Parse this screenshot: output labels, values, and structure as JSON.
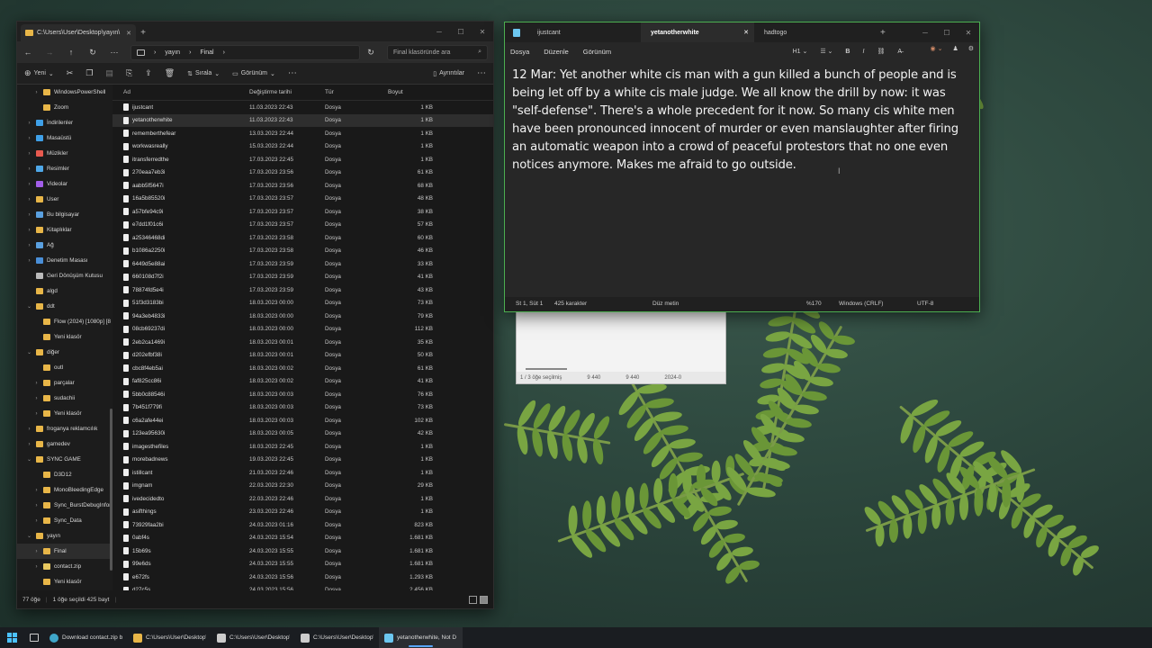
{
  "explorer": {
    "tab_title": "C:\\Users\\User\\Desktop\\yayın\\",
    "breadcrumb": [
      "yayın",
      "Final"
    ],
    "search_placeholder": "Final klasöründe ara",
    "commands": {
      "new": "Yeni",
      "sort": "Sırala",
      "view": "Görünüm",
      "details": "Ayrıntılar"
    },
    "columns": {
      "name": "Ad",
      "date": "Değiştirme tarihi",
      "type": "Tür",
      "size": "Boyut"
    },
    "nav": [
      {
        "label": "WindowsPowerShell",
        "indent": 1,
        "chev": true,
        "color": "#e8b648"
      },
      {
        "label": "Zoom",
        "indent": 1,
        "chev": false,
        "color": "#e8b648"
      },
      {
        "label": "İndirilenler",
        "indent": 0,
        "chev": true,
        "color": "#3fa0e8"
      },
      {
        "label": "Masaüstü",
        "indent": 0,
        "chev": true,
        "color": "#3fa0e8"
      },
      {
        "label": "Müzikler",
        "indent": 0,
        "chev": true,
        "color": "#e85a4f"
      },
      {
        "label": "Resimler",
        "indent": 0,
        "chev": true,
        "color": "#4fa8e8"
      },
      {
        "label": "Videolar",
        "indent": 0,
        "chev": true,
        "color": "#a25ee8"
      },
      {
        "label": "User",
        "indent": 0,
        "chev": true,
        "color": "#e8b648"
      },
      {
        "label": "Bu bilgisayar",
        "indent": 0,
        "chev": true,
        "color": "#5aa0e0"
      },
      {
        "label": "Kitaplıklar",
        "indent": 0,
        "chev": true,
        "color": "#e8b648"
      },
      {
        "label": "Ağ",
        "indent": 0,
        "chev": true,
        "color": "#5aa0e0"
      },
      {
        "label": "Denetim Masası",
        "indent": 0,
        "chev": true,
        "color": "#4a8fd8"
      },
      {
        "label": "Geri Dönüşüm Kutusu",
        "indent": 0,
        "chev": false,
        "color": "#bbbbbb"
      },
      {
        "label": "algd",
        "indent": 0,
        "chev": false,
        "color": "#e8b648"
      },
      {
        "label": "ddt",
        "indent": 0,
        "chev": true,
        "open": true,
        "color": "#e8b648"
      },
      {
        "label": "Flow (2024) [1080p] [8",
        "indent": 1,
        "chev": false,
        "color": "#e8b648"
      },
      {
        "label": "Yeni klasör",
        "indent": 1,
        "chev": false,
        "color": "#e8b648"
      },
      {
        "label": "diğer",
        "indent": 0,
        "chev": true,
        "open": true,
        "color": "#e8b648"
      },
      {
        "label": "outl",
        "indent": 1,
        "chev": false,
        "color": "#e8b648"
      },
      {
        "label": "parçalar",
        "indent": 1,
        "chev": true,
        "color": "#e8b648"
      },
      {
        "label": "sudachii",
        "indent": 1,
        "chev": true,
        "color": "#e8b648"
      },
      {
        "label": "Yeni klasör",
        "indent": 1,
        "chev": true,
        "color": "#e8b648"
      },
      {
        "label": "froganya reklamcılık",
        "indent": 0,
        "chev": true,
        "color": "#e8b648"
      },
      {
        "label": "gamedev",
        "indent": 0,
        "chev": true,
        "color": "#e8b648"
      },
      {
        "label": "SYNC GAME",
        "indent": 0,
        "chev": true,
        "open": true,
        "color": "#e8b648"
      },
      {
        "label": "D3D12",
        "indent": 1,
        "chev": false,
        "color": "#e8b648"
      },
      {
        "label": "MonoBleedingEdge",
        "indent": 1,
        "chev": true,
        "color": "#e8b648"
      },
      {
        "label": "Sync_BurstDebugInforr",
        "indent": 1,
        "chev": true,
        "color": "#e8b648"
      },
      {
        "label": "Sync_Data",
        "indent": 1,
        "chev": true,
        "color": "#e8b648"
      },
      {
        "label": "yayın",
        "indent": 0,
        "chev": true,
        "open": true,
        "color": "#e8b648"
      },
      {
        "label": "Final",
        "indent": 1,
        "chev": true,
        "sel": true,
        "color": "#e8b648"
      },
      {
        "label": "contact.zip",
        "indent": 1,
        "chev": true,
        "color": "#e8c860"
      },
      {
        "label": "Yeni klasör",
        "indent": 1,
        "chev": false,
        "color": "#e8b648"
      }
    ],
    "files": [
      {
        "name": "ijustcant",
        "date": "11.03.2023 22:43",
        "type": "Dosya",
        "size": "1 KB"
      },
      {
        "name": "yetanotherwhite",
        "date": "11.03.2023 22:43",
        "type": "Dosya",
        "size": "1 KB",
        "sel": true
      },
      {
        "name": "rememberthefear",
        "date": "13.03.2023 22:44",
        "type": "Dosya",
        "size": "1 KB"
      },
      {
        "name": "workwasreally",
        "date": "15.03.2023 22:44",
        "type": "Dosya",
        "size": "1 KB"
      },
      {
        "name": "itransferredthe",
        "date": "17.03.2023 22:45",
        "type": "Dosya",
        "size": "1 KB"
      },
      {
        "name": "270eaa7eb3i",
        "date": "17.03.2023 23:56",
        "type": "Dosya",
        "size": "61 KB"
      },
      {
        "name": "aabb5f5647i",
        "date": "17.03.2023 23:56",
        "type": "Dosya",
        "size": "68 KB"
      },
      {
        "name": "16a5b85520i",
        "date": "17.03.2023 23:57",
        "type": "Dosya",
        "size": "48 KB"
      },
      {
        "name": "a57bfe94c9i",
        "date": "17.03.2023 23:57",
        "type": "Dosya",
        "size": "38 KB"
      },
      {
        "name": "e7dd1f01c6i",
        "date": "17.03.2023 23:57",
        "type": "Dosya",
        "size": "57 KB"
      },
      {
        "name": "a25346468di",
        "date": "17.03.2023 23:58",
        "type": "Dosya",
        "size": "60 KB"
      },
      {
        "name": "b1086a2250i",
        "date": "17.03.2023 23:58",
        "type": "Dosya",
        "size": "46 KB"
      },
      {
        "name": "6449d5e88ai",
        "date": "17.03.2023 23:59",
        "type": "Dosya",
        "size": "33 KB"
      },
      {
        "name": "660108d7f2i",
        "date": "17.03.2023 23:59",
        "type": "Dosya",
        "size": "41 KB"
      },
      {
        "name": "78874fd5e4i",
        "date": "17.03.2023 23:59",
        "type": "Dosya",
        "size": "43 KB"
      },
      {
        "name": "51f3d3183bi",
        "date": "18.03.2023 00:00",
        "type": "Dosya",
        "size": "73 KB"
      },
      {
        "name": "94a3eb4833i",
        "date": "18.03.2023 00:00",
        "type": "Dosya",
        "size": "79 KB"
      },
      {
        "name": "08cb69237di",
        "date": "18.03.2023 00:00",
        "type": "Dosya",
        "size": "112 KB"
      },
      {
        "name": "2eb2ca1469i",
        "date": "18.03.2023 00:01",
        "type": "Dosya",
        "size": "35 KB"
      },
      {
        "name": "d202efbf38i",
        "date": "18.03.2023 00:01",
        "type": "Dosya",
        "size": "50 KB"
      },
      {
        "name": "cbc8f4eb5ai",
        "date": "18.03.2023 00:02",
        "type": "Dosya",
        "size": "61 KB"
      },
      {
        "name": "faf825cc86i",
        "date": "18.03.2023 00:02",
        "type": "Dosya",
        "size": "41 KB"
      },
      {
        "name": "5bb0c88546i",
        "date": "18.03.2023 00:03",
        "type": "Dosya",
        "size": "76 KB"
      },
      {
        "name": "7b451f779fi",
        "date": "18.03.2023 00:03",
        "type": "Dosya",
        "size": "73 KB"
      },
      {
        "name": "c6a2afe44ei",
        "date": "18.03.2023 00:03",
        "type": "Dosya",
        "size": "102 KB"
      },
      {
        "name": "123ea95630i",
        "date": "18.03.2023 00:05",
        "type": "Dosya",
        "size": "42 KB"
      },
      {
        "name": "imagesthefiles",
        "date": "18.03.2023 22:45",
        "type": "Dosya",
        "size": "1 KB"
      },
      {
        "name": "morebadnews",
        "date": "19.03.2023 22:45",
        "type": "Dosya",
        "size": "1 KB"
      },
      {
        "name": "istillcant",
        "date": "21.03.2023 22:46",
        "type": "Dosya",
        "size": "1 KB"
      },
      {
        "name": "imgnam",
        "date": "22.03.2023 22:30",
        "type": "Dosya",
        "size": "29 KB"
      },
      {
        "name": "ivedecidedto",
        "date": "22.03.2023 22:46",
        "type": "Dosya",
        "size": "1 KB"
      },
      {
        "name": "asifthings",
        "date": "23.03.2023 22:46",
        "type": "Dosya",
        "size": "1 KB"
      },
      {
        "name": "73929faa2bi",
        "date": "24.03.2023 01:16",
        "type": "Dosya",
        "size": "823 KB"
      },
      {
        "name": "0abf4s",
        "date": "24.03.2023 15:54",
        "type": "Dosya",
        "size": "1.681 KB"
      },
      {
        "name": "15b69s",
        "date": "24.03.2023 15:55",
        "type": "Dosya",
        "size": "1.681 KB"
      },
      {
        "name": "99e6ds",
        "date": "24.03.2023 15:55",
        "type": "Dosya",
        "size": "1.681 KB"
      },
      {
        "name": "e672fs",
        "date": "24.03.2023 15:56",
        "type": "Dosya",
        "size": "1.293 KB"
      },
      {
        "name": "d27c5s",
        "date": "24.03.2023 15:56",
        "type": "Dosya",
        "size": "2.456 KB"
      }
    ],
    "status": {
      "count": "77 öğe",
      "selected": "1 öğe seçildi  425 bayt"
    }
  },
  "behind_window": {
    "status": "1 / 3 öğe seçilmiş",
    "v1": "9 440",
    "v2": "9 440",
    "v3": "2024-0"
  },
  "notepad": {
    "tabs": [
      {
        "label": "ijustcant",
        "active": false
      },
      {
        "label": "yetanotherwhite",
        "active": true
      },
      {
        "label": "hadtogo",
        "active": false
      }
    ],
    "menu": {
      "file": "Dosya",
      "edit": "Düzenle",
      "view": "Görünüm"
    },
    "heading_btn": "H1",
    "content": "12 Mar: Yet another white cis man with a gun killed a bunch of people and is being let off by a white cis male judge. We all know the drill by now: it was \"self-defense\". There's a whole precedent for it now. So many cis white men have been pronounced innocent of murder or even manslaughter after firing an automatic weapon into a crowd of peaceful protestors that no one even notices anymore. Makes me afraid to go outside.",
    "status": {
      "position": "St 1, Süt 1",
      "chars": "425 karakter",
      "format": "Düz metin",
      "zoom": "%170",
      "eol": "Windows (CRLF)",
      "encoding": "UTF-8"
    }
  },
  "taskbar": {
    "items": [
      {
        "label": "Download contact.zip b",
        "kind": "edge"
      },
      {
        "label": "C:\\Users\\User\\Desktop\\",
        "kind": "folder"
      },
      {
        "label": "C:\\Users\\User\\Desktop\\",
        "kind": "cmd"
      },
      {
        "label": "C:\\Users\\User\\Desktop\\",
        "kind": "cmd"
      },
      {
        "label": "yetanotherwhite, Not D",
        "kind": "notepad",
        "active": true
      }
    ]
  },
  "colors": {
    "accent": "#4cc2ff",
    "folder": "#e8b648",
    "notepad_border": "#4caf50"
  }
}
